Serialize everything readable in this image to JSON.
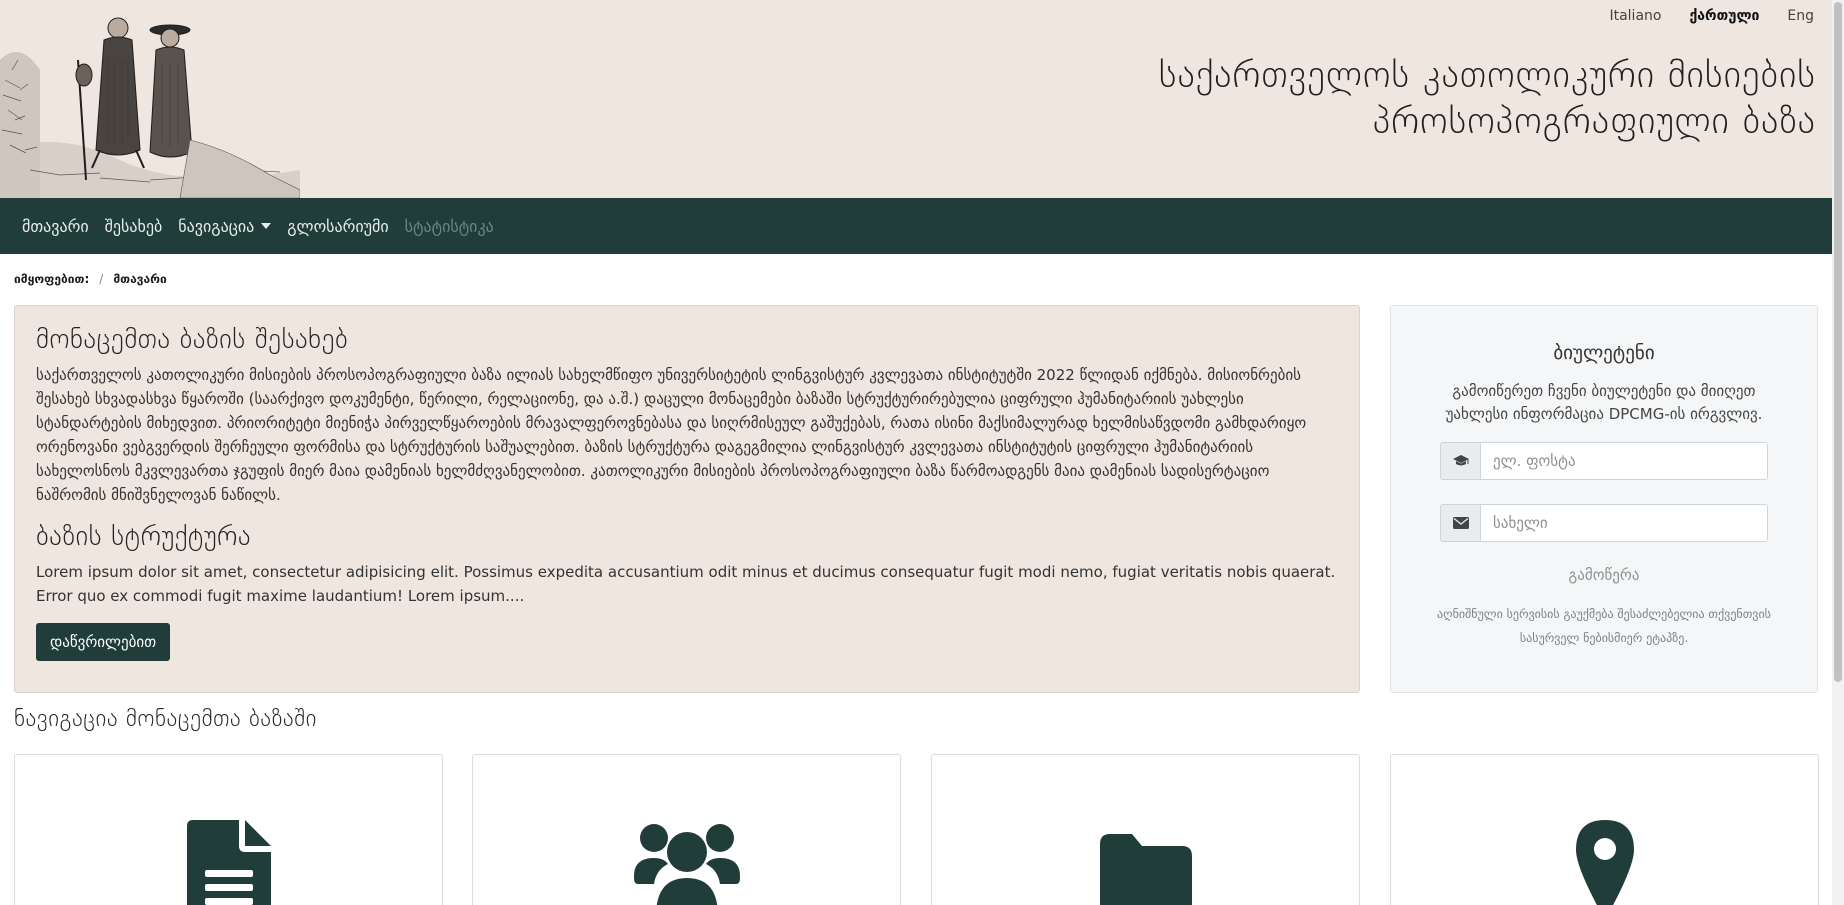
{
  "header": {
    "languages": [
      {
        "label": "Italiano",
        "active": false
      },
      {
        "label": "ქართული",
        "active": true
      },
      {
        "label": "Eng",
        "active": false
      }
    ],
    "title_line1": "საქართველოს კათოლიკური მისიების",
    "title_line2": "პროსოპოგრაფიული ბაზა"
  },
  "navbar": {
    "items": [
      {
        "label": "მთავარი"
      },
      {
        "label": "შესახებ"
      },
      {
        "label": "ნავიგაცია"
      },
      {
        "label": "გლოსარიუმი"
      },
      {
        "label": "სტატისტიკა"
      }
    ]
  },
  "breadcrumb": {
    "prefix": "იმყოფებით:",
    "current": "მთავარი"
  },
  "about": {
    "title": "მონაცემთა ბაზის შესახებ",
    "text": "საქართველოს კათოლიკური მისიების პროსოპოგრაფიული ბაზა ილიას სახელმწიფო უნივერსიტეტის ლინგვისტურ კვლევათა ინსტიტუტში 2022 წლიდან იქმნება. მისიონრების შესახებ სხვადასხვა წყაროში (საარქივო დოკუმენტი, წერილი, რელაციონე, და ა.შ.) დაცული მონაცემები ბაზაში სტრუქტურირებულია ციფრული ჰუმანიტარიის უახლესი სტანდარტების მიხედვით. პრიორიტეტი მიენიჭა პირველწყაროების მრავალფეროვნებასა და სიღრმისეულ გაშუქებას, რათა ისინი მაქსიმალურად ხელმისაწვდომი გამხდარიყო ორენოვანი ვებგვერდის შერჩეული ფორმისა და სტრუქტურის საშუალებით. ბაზის სტრუქტურა დაგეგმილია ლინგვისტურ კვლევათა ინსტიტუტის ციფრული ჰუმანიტარიის სახელოსნოს მკვლევართა ჯგუფის მიერ მაია დამენიას ხელმძღვანელობით. კათოლიკური მისიების პროსოპოგრაფიული ბაზა წარმოადგენს მაია დამენიას სადისერტაციო ნაშრომის მნიშვნელოვან ნაწილს.",
    "structure_title": "ბაზის სტრუქტურა",
    "structure_text": "Lorem ipsum dolor sit amet, consectetur adipisicing elit. Possimus expedita accusantium odit minus et ducimus consequatur fugit modi nemo, fugiat veritatis nobis quaerat. Error quo ex commodi fugit maxime laudantium! Lorem ipsum....",
    "button_label": "დაწვრილებით"
  },
  "newsletter": {
    "title": "ბიულეტენი",
    "description": "გამოიწერეთ ჩვენი ბიულეტენი და მიიღეთ უახლესი ინფორმაცია DPCMG-ის ირგვლივ.",
    "email_placeholder": "ელ. ფოსტა",
    "name_placeholder": "სახელი",
    "submit_label": "გამოწერა",
    "note": "აღნიშნული სერვისის გაუქმება შესაძლებელია თქვენთვის სასურველ ნებისმიერ ეტაპზე."
  },
  "navigation_section": {
    "title": "ნავიგაცია მონაცემთა ბაზაში",
    "cards": [
      {
        "icon": "document-icon"
      },
      {
        "icon": "users-icon"
      },
      {
        "icon": "folder-icon"
      },
      {
        "icon": "map-marker-icon"
      }
    ]
  },
  "colors": {
    "header_bg": "#efe6e0",
    "navbar_bg": "#213d3a",
    "accent": "#213d3a"
  }
}
